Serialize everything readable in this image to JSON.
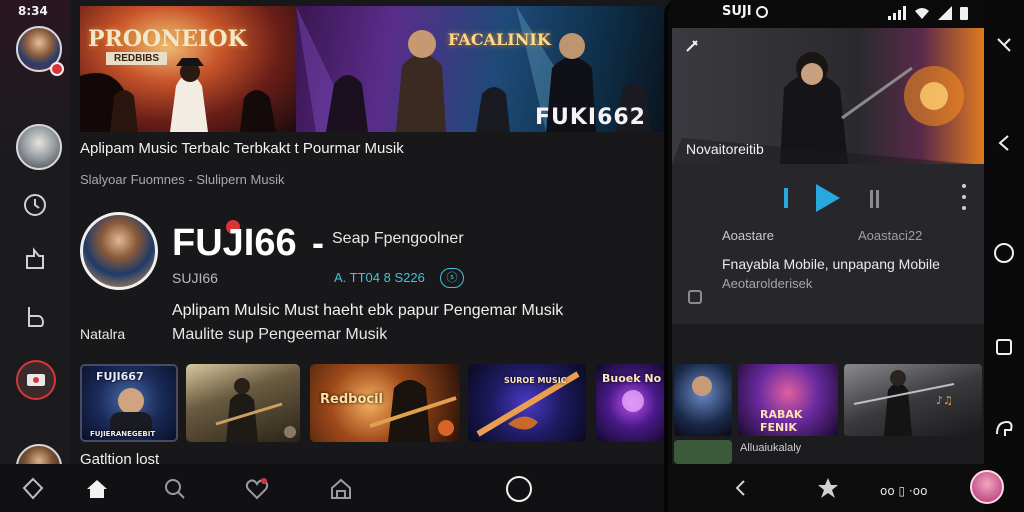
{
  "left": {
    "time": "8:34",
    "banner": {
      "logo_text": "PROONEIOK",
      "logo_subtext": "REDBIBS",
      "middle_logo": "FACALINIK",
      "brand": "FUKI662"
    },
    "tagline": "Aplipam Music Terbalc Terbkakt t Pourmar Musik",
    "sub_tagline": "Slalyoar Fuomnes - Slulipern Musik",
    "profile": {
      "name": "FUJI66",
      "dash": "-",
      "role": "Seap Fpengoolner",
      "handle": "SUJI66",
      "stat": "A. TT04 8 S226",
      "stat_pill": "ⓢ"
    },
    "description_1": "Aplipam Mulsic Must haeht ebk papur Pengemar Musik",
    "description_2": "Maulite sup Pengeemar Musik",
    "section_label": "Natalra",
    "thumbnails": [
      {
        "label": "FUJI667",
        "caption": "FUJIERANEGEBIT"
      },
      {
        "label": ""
      },
      {
        "label": "Redbocil"
      },
      {
        "label": "SUROE MUSIC"
      },
      {
        "label": "Buoek No"
      }
    ],
    "bottom_text": "Gatltion lost",
    "nav_icons": [
      "home-icon",
      "search-icon",
      "heart-icon",
      "library-icon"
    ]
  },
  "phone": {
    "status_time": "SUJI",
    "hero_title": "Novaitoreitib",
    "track_left": "Aoastare",
    "track_right": "Aoastaci22",
    "list_title": "Fnayabla Mobile, unpapang Mobile",
    "list_sub": "Aeotarolderisek",
    "thumb_caption": "RABAK FENIK",
    "thumb_caption_2": "Alluaiukalaly",
    "bottom_text": "oo  ▯ ·oo"
  },
  "colors": {
    "accent": "#29a8e0",
    "stat": "#3fc3d6",
    "badge": "#d8343a"
  }
}
